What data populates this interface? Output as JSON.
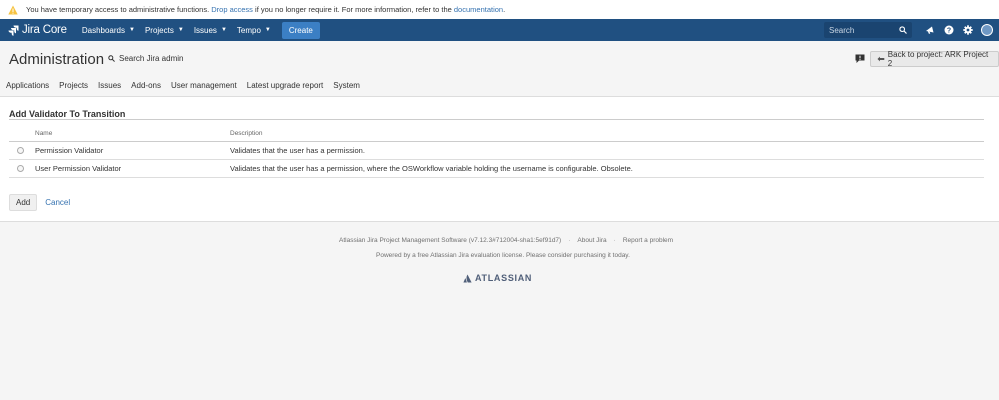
{
  "banner": {
    "text_before": "You have temporary access to administrative functions.",
    "drop_access": "Drop access",
    "text_middle": "if you no longer require it. For more information, refer to the",
    "documentation": "documentation",
    "text_end": "."
  },
  "nav": {
    "logo": "Jira Core",
    "items": [
      {
        "label": "Dashboards"
      },
      {
        "label": "Projects"
      },
      {
        "label": "Issues"
      },
      {
        "label": "Tempo"
      }
    ],
    "create": "Create",
    "search_placeholder": "Search"
  },
  "admin": {
    "title": "Administration",
    "search": "Search Jira admin",
    "back": "Back to project: ARK Project 2",
    "tabs": [
      {
        "label": "Applications"
      },
      {
        "label": "Projects"
      },
      {
        "label": "Issues"
      },
      {
        "label": "Add-ons"
      },
      {
        "label": "User management"
      },
      {
        "label": "Latest upgrade report"
      },
      {
        "label": "System"
      }
    ]
  },
  "form": {
    "heading": "Add Validator To Transition",
    "columns": {
      "name": "Name",
      "description": "Description"
    },
    "rows": [
      {
        "name": "Permission Validator",
        "description": "Validates that the user has a permission."
      },
      {
        "name": "User Permission Validator",
        "description": "Validates that the user has a permission, where the OSWorkflow variable holding the username is configurable. Obsolete."
      }
    ],
    "add": "Add",
    "cancel": "Cancel"
  },
  "footer": {
    "software": "Atlassian Jira Project Management Software (v7.12.3#712004-sha1:5ef91d7)",
    "about": "About Jira",
    "report": "Report a problem",
    "powered": "Powered by a free Atlassian Jira evaluation license. Please consider purchasing it today.",
    "atlassian": "ATLASSIAN"
  },
  "colors": {
    "nav_bg": "#205081",
    "create_btn": "#3b7fc4",
    "link": "#3572b0",
    "warning": "#f6c342"
  },
  "icons": [
    "warning-icon",
    "jira-logo-icon",
    "chevron-down-icon",
    "search-icon",
    "notification-icon",
    "help-icon",
    "gear-icon",
    "feedback-icon",
    "back-arrow-icon",
    "atlassian-logo-icon"
  ]
}
